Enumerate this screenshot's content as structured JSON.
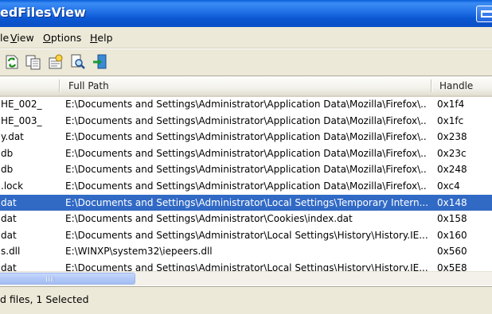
{
  "window": {
    "title": "edFilesView"
  },
  "menu": {
    "items": [
      {
        "label": "le",
        "accel": ""
      },
      {
        "label": "iew",
        "accel": "V"
      },
      {
        "label": "ptions",
        "accel": "O"
      },
      {
        "label": "elp",
        "accel": "H"
      }
    ]
  },
  "toolbar": {
    "buttons": [
      {
        "icon": "refresh-icon"
      },
      {
        "icon": "copy-icon"
      },
      {
        "icon": "properties-icon"
      },
      {
        "icon": "find-icon"
      },
      {
        "icon": "exit-icon"
      }
    ]
  },
  "list": {
    "columns": {
      "name": "",
      "path": "Full Path",
      "handle": "Handle"
    },
    "rows": [
      {
        "name": "HE_002_",
        "path": "E:\\Documents and Settings\\Administrator\\Application Data\\Mozilla\\Firefox\\...",
        "handle": "0x1f4",
        "selected": false
      },
      {
        "name": "HE_003_",
        "path": "E:\\Documents and Settings\\Administrator\\Application Data\\Mozilla\\Firefox\\...",
        "handle": "0x1fc",
        "selected": false
      },
      {
        "name": "y.dat",
        "path": "E:\\Documents and Settings\\Administrator\\Application Data\\Mozilla\\Firefox\\...",
        "handle": "0x238",
        "selected": false
      },
      {
        "name": "db",
        "path": "E:\\Documents and Settings\\Administrator\\Application Data\\Mozilla\\Firefox\\...",
        "handle": "0x23c",
        "selected": false
      },
      {
        "name": "db",
        "path": "E:\\Documents and Settings\\Administrator\\Application Data\\Mozilla\\Firefox\\...",
        "handle": "0x248",
        "selected": false
      },
      {
        "name": ".lock",
        "path": "E:\\Documents and Settings\\Administrator\\Application Data\\Mozilla\\Firefox\\...",
        "handle": "0xc4",
        "selected": false
      },
      {
        "name": "dat",
        "path": "E:\\Documents and Settings\\Administrator\\Local Settings\\Temporary Intern...",
        "handle": "0x148",
        "selected": true
      },
      {
        "name": "dat",
        "path": "E:\\Documents and Settings\\Administrator\\Cookies\\index.dat",
        "handle": "0x158",
        "selected": false
      },
      {
        "name": "dat",
        "path": "E:\\Documents and Settings\\Administrator\\Local Settings\\History\\History.IE...",
        "handle": "0x160",
        "selected": false
      },
      {
        "name": "s.dll",
        "path": "E:\\WINXP\\system32\\iepeers.dll",
        "handle": "0x560",
        "selected": false
      },
      {
        "name": "dat",
        "path": "E:\\Documents and Settings\\Administrator\\Local Settings\\History\\History.IE...",
        "handle": "0x5E8",
        "selected": false
      }
    ]
  },
  "status": {
    "text": "d files, 1 Selected"
  }
}
